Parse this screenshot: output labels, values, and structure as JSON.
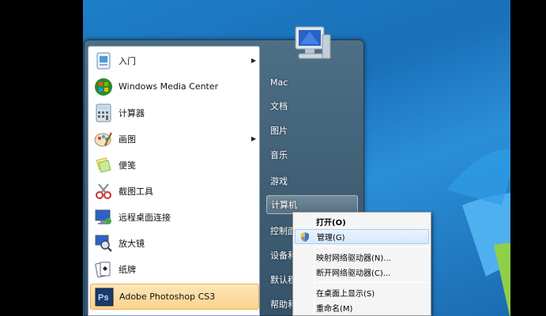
{
  "start_menu": {
    "programs": [
      {
        "label": "入门",
        "icon": "getting-started-icon",
        "has_submenu": true
      },
      {
        "label": "Windows Media Center",
        "icon": "media-center-icon",
        "has_submenu": false
      },
      {
        "label": "计算器",
        "icon": "calculator-icon",
        "has_submenu": false
      },
      {
        "label": "画图",
        "icon": "paint-icon",
        "has_submenu": true
      },
      {
        "label": "便笺",
        "icon": "sticky-notes-icon",
        "has_submenu": false
      },
      {
        "label": "截图工具",
        "icon": "snipping-tool-icon",
        "has_submenu": false
      },
      {
        "label": "远程桌面连接",
        "icon": "remote-desktop-icon",
        "has_submenu": false
      },
      {
        "label": "放大镜",
        "icon": "magnifier-icon",
        "has_submenu": false
      },
      {
        "label": "纸牌",
        "icon": "solitaire-icon",
        "has_submenu": false
      },
      {
        "label": "Adobe Photoshop CS3",
        "icon": "photoshop-icon",
        "has_submenu": false
      }
    ],
    "right_items": [
      "Mac",
      "文档",
      "图片",
      "音乐",
      "游戏",
      "计算机",
      "控制面",
      "设备和",
      "默认程",
      "帮助和"
    ]
  },
  "context_menu": {
    "items": [
      {
        "label": "打开(O)",
        "bold": true
      },
      {
        "label": "管理(G)",
        "shield": true,
        "highlighted": true
      },
      {
        "label": "映射网络驱动器(N)..."
      },
      {
        "label": "断开网络驱动器(C)..."
      },
      {
        "label": "在桌面上显示(S)"
      },
      {
        "label": "重命名(M)"
      }
    ]
  },
  "colors": {
    "desktop": "#1a6fb8",
    "menu_dark": "#3e5d73",
    "highlight": "#fbd38d",
    "ctx_highlight": "#d7e8fb"
  }
}
